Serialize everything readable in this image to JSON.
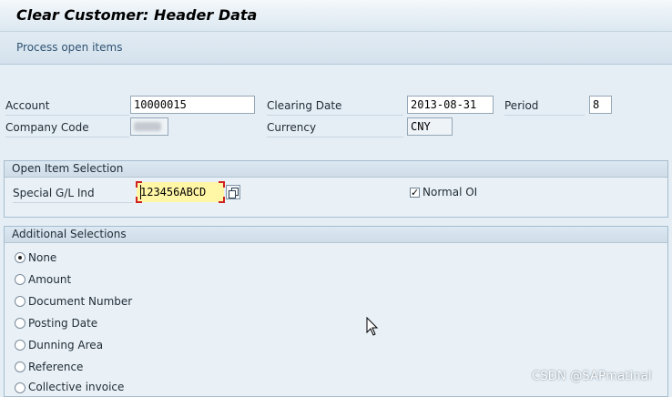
{
  "window": {
    "title": "Clear Customer: Header Data"
  },
  "toolbar": {
    "process_open_items": "Process open items"
  },
  "header": {
    "account_label": "Account",
    "account_value": "10000015",
    "clearing_date_label": "Clearing Date",
    "clearing_date_value": "2013-08-31",
    "period_label": "Period",
    "period_value": "8",
    "company_code_label": "Company Code",
    "company_code_value": "",
    "currency_label": "Currency",
    "currency_value": "CNY"
  },
  "open_item_selection": {
    "title": "Open Item Selection",
    "special_gl_label": "Special G/L Ind",
    "special_gl_value": "123456ABCD",
    "normal_oi_label": "Normal OI",
    "normal_oi_checked": true
  },
  "additional_selections": {
    "title": "Additional Selections",
    "options": [
      "None",
      "Amount",
      "Document Number",
      "Posting Date",
      "Dunning Area",
      "Reference",
      "Collective invoice"
    ],
    "selected": "None"
  },
  "watermark": "CSDN @SAPmatinal"
}
